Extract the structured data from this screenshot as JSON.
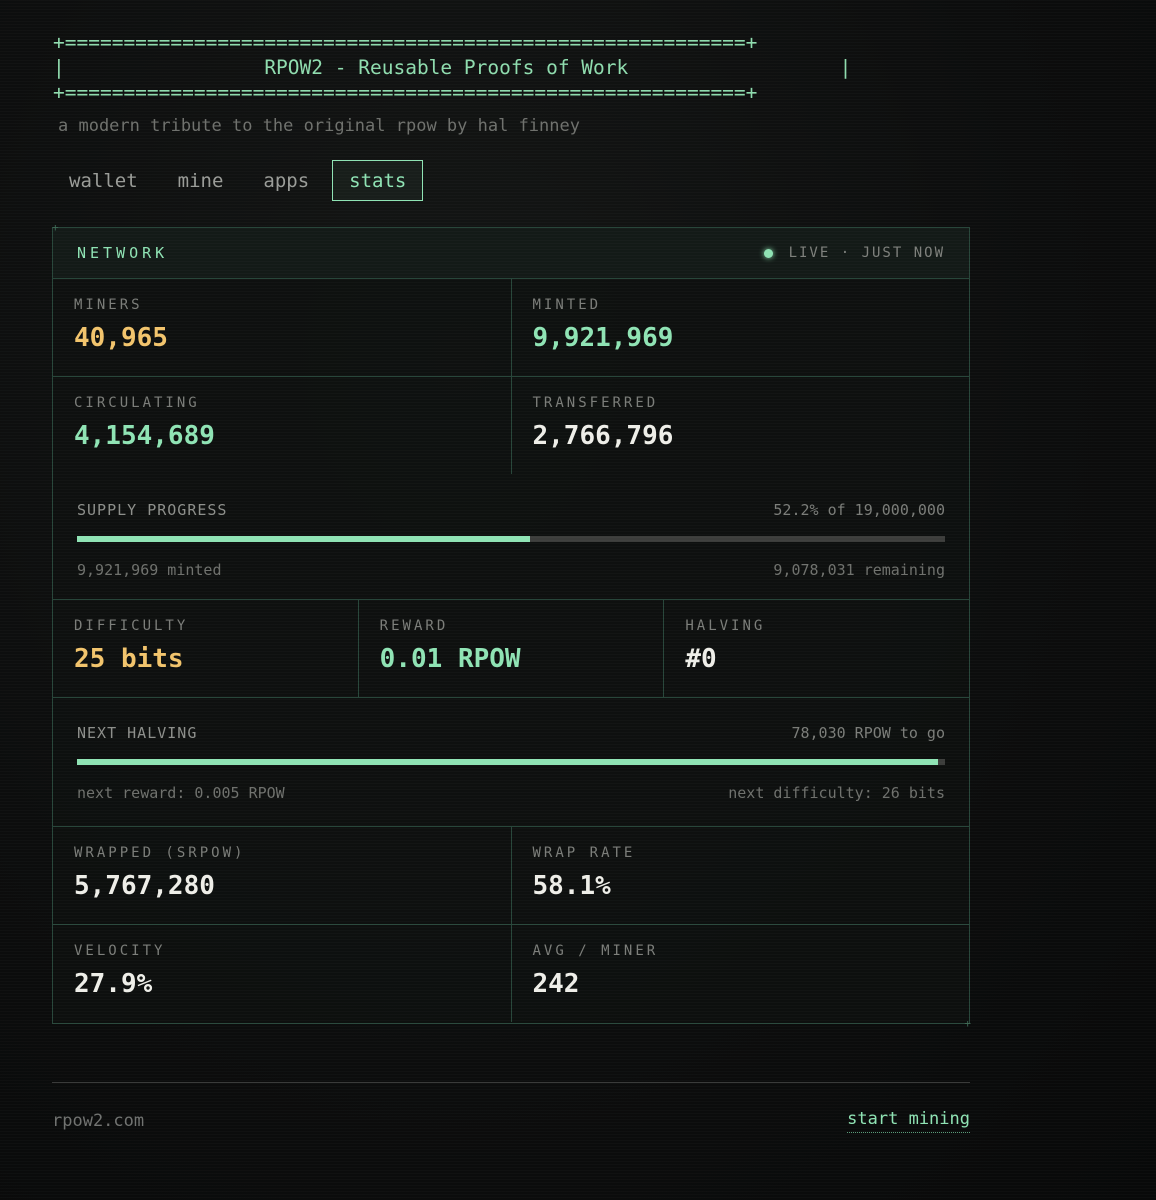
{
  "header": {
    "banner": "+==========================================================+\n|                 RPOW2 - Reusable Proofs of Work                  |\n+==========================================================+",
    "subtitle": "a modern tribute to the original rpow by hal finney"
  },
  "tabs": [
    {
      "label": "wallet",
      "active": false
    },
    {
      "label": "mine",
      "active": false
    },
    {
      "label": "apps",
      "active": false
    },
    {
      "label": "stats",
      "active": true
    }
  ],
  "network": {
    "title": "NETWORK",
    "live_status": "LIVE · JUST NOW",
    "stats_top": [
      [
        {
          "label": "MINERS",
          "value": "40,965"
        },
        {
          "label": "MINTED",
          "value": "9,921,969"
        }
      ],
      [
        {
          "label": "CIRCULATING",
          "value": "4,154,689"
        },
        {
          "label": "TRANSFERRED",
          "value": "2,766,796"
        }
      ]
    ],
    "supply_progress": {
      "label": "SUPPLY PROGRESS",
      "summary": "52.2% of 19,000,000",
      "fill_fraction": 0.522,
      "minted_text": "9,921,969 minted",
      "remaining_text": "9,078,031 remaining"
    },
    "params": [
      {
        "label": "DIFFICULTY",
        "value": "25 bits"
      },
      {
        "label": "REWARD",
        "value": "0.01 RPOW"
      },
      {
        "label": "HALVING",
        "value": "#0"
      }
    ],
    "next_halving": {
      "label": "NEXT HALVING",
      "summary": "78,030 RPOW to go",
      "fill_fraction": 0.992,
      "next_reward": "next reward: 0.005 RPOW",
      "next_difficulty": "next difficulty: 26 bits"
    },
    "stats_bottom": [
      [
        {
          "label": "WRAPPED (SRPOW)",
          "value": "5,767,280"
        },
        {
          "label": "WRAP RATE",
          "value": "58.1%"
        }
      ],
      [
        {
          "label": "VELOCITY",
          "value": "27.9%"
        },
        {
          "label": "AVG / MINER",
          "value": "242"
        }
      ]
    ]
  },
  "footer": {
    "domain": "rpow2.com",
    "cta": "start mining"
  },
  "colors": {
    "accent": "#8fe3b4",
    "highlight": "#f2c46c",
    "border": "#28463a",
    "background": "#0d0e0e"
  }
}
